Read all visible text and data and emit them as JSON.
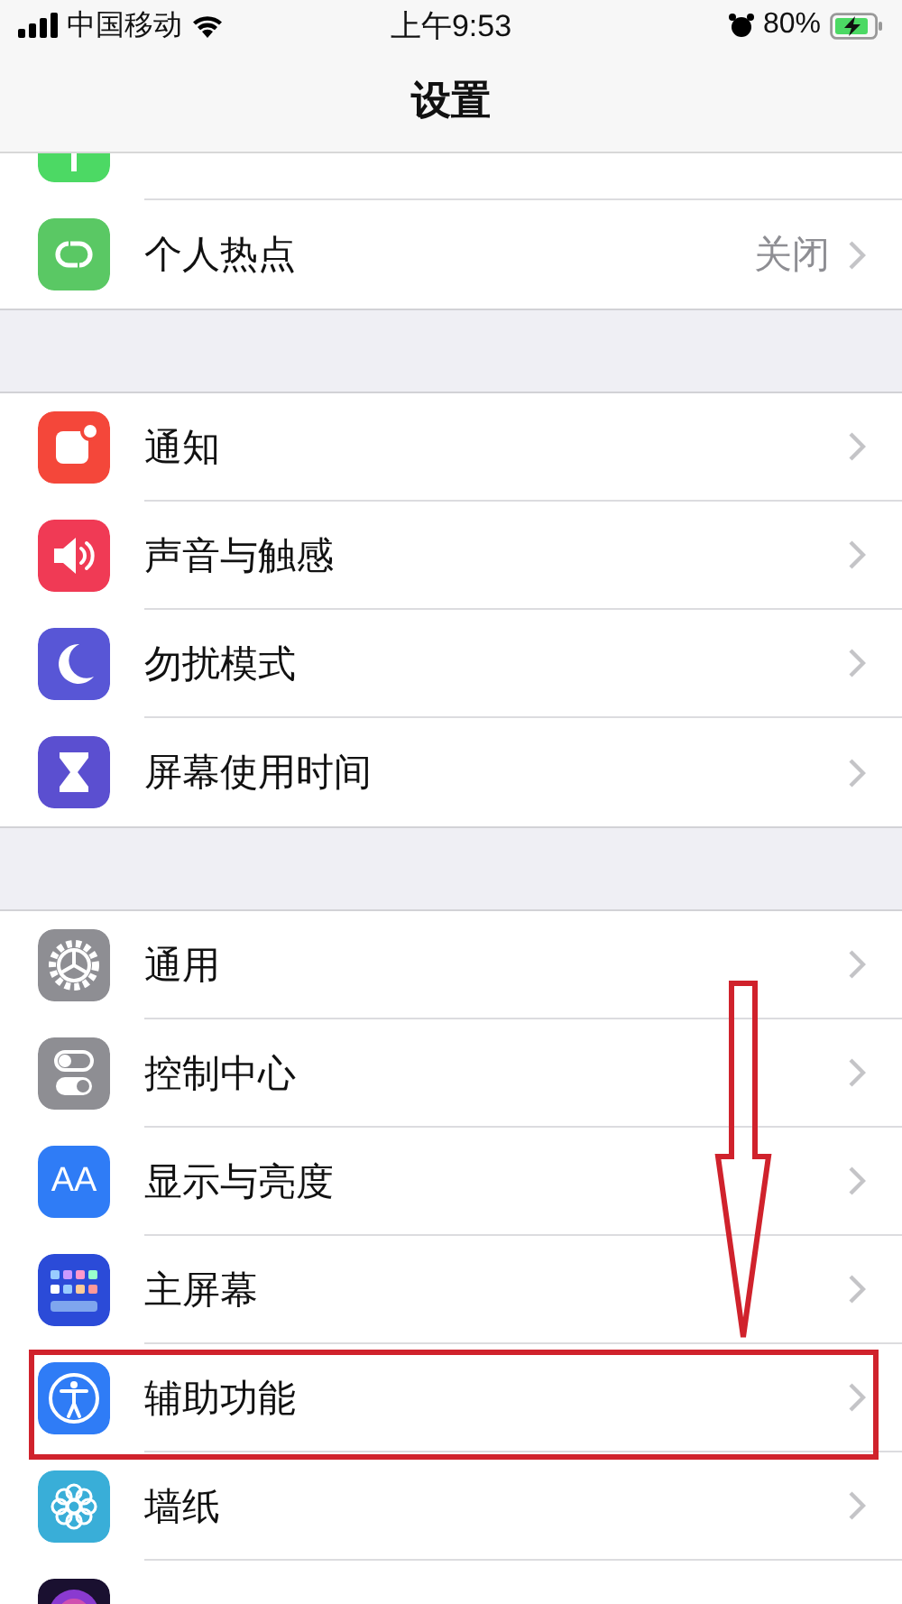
{
  "status_bar": {
    "carrier": "中国移动",
    "time": "上午9:53",
    "battery": "80%"
  },
  "nav_bar": {
    "title": "设置"
  },
  "groups": [
    {
      "items": [
        {
          "kind": "cellular"
        },
        {
          "kind": "hotspot",
          "label": "个人热点",
          "value": "关闭",
          "highlighted": false
        }
      ]
    },
    {
      "items": [
        {
          "kind": "notifications",
          "label": "通知",
          "highlighted": false
        },
        {
          "kind": "sounds",
          "label": "声音与触感",
          "highlighted": false
        },
        {
          "kind": "moon",
          "label": "勿扰模式",
          "highlighted": false
        },
        {
          "kind": "hourglass",
          "label": "屏幕使用时间",
          "highlighted": false
        }
      ]
    },
    {
      "items": [
        {
          "kind": "gear",
          "label": "通用",
          "highlighted": false
        },
        {
          "kind": "switches",
          "label": "控制中心",
          "highlighted": false
        },
        {
          "kind": "display",
          "icon_text": "AA",
          "label": "显示与亮度",
          "highlighted": false
        },
        {
          "kind": "home",
          "label": "主屏幕",
          "highlighted": false
        },
        {
          "kind": "accessibility",
          "label": "辅助功能",
          "highlighted": true
        },
        {
          "kind": "wallpaper",
          "label": "墙纸",
          "highlighted": false
        },
        {
          "kind": "siri"
        }
      ]
    }
  ]
}
